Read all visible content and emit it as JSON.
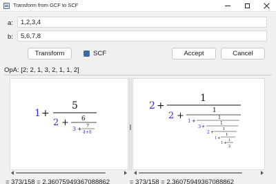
{
  "window": {
    "title": "Transform from GCF to SCF",
    "icon": "app-window-icon",
    "controls": {
      "minimize": "minimize-icon",
      "maximize": "maximize-icon",
      "close": "close-icon"
    }
  },
  "fields": {
    "a": {
      "label": "a:",
      "value": "1,2,3,4"
    },
    "b": {
      "label": "b:",
      "value": "5,6,7,8"
    }
  },
  "toolbar": {
    "transform_label": "Transform",
    "scf_label": "SCF",
    "scf_checked": true,
    "accept_label": "Accept",
    "cancel_label": "Cancel"
  },
  "opa": {
    "text": "OpA: [2; 2, 1, 3, 2, 1, 1, 2]"
  },
  "left_panel": {
    "t1": "1",
    "plus1": "+",
    "num1": "5",
    "t2": "2",
    "plus2": "+",
    "num2": "6",
    "t3": "3",
    "plus3": "+",
    "num3": "7",
    "den3": "4+8"
  },
  "right_panel": {
    "a0": "2",
    "n0": "1",
    "a1": "2",
    "n1": "1",
    "a2": "1",
    "n2": "1",
    "a3": "3",
    "n3": "1",
    "a4": "2",
    "n4": "1",
    "a5": "1",
    "n5": "1",
    "a6": "1",
    "n6": "1",
    "a7": "2",
    "plus": "+"
  },
  "results": {
    "left": "= 373/158 = 2.36075949367088862",
    "right": "= 373/158 = 2.36075949367088862"
  },
  "colors": {
    "accent": "#3b6aa8",
    "math_blue": "#2c2cd8",
    "math_black": "#111111"
  }
}
